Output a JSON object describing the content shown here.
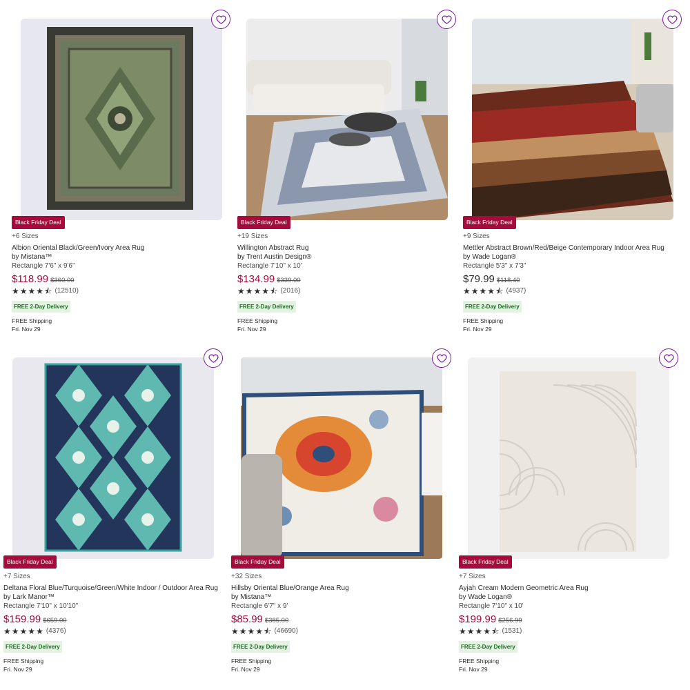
{
  "products": [
    {
      "badge": "Black Friday Deal",
      "sizes": "+6 Sizes",
      "name": "Albion Oriental Black/Green/Ivory Area Rug",
      "brand": "by Mistana™",
      "dims": "Rectangle 7'6\" x 9'6\"",
      "price": "$118.99",
      "was": "$360.00",
      "rating": 4.5,
      "reviews": "(12510)",
      "free": "FREE 2-Day Delivery",
      "ship": "FREE Shipping",
      "date": "Fri. Nov 29",
      "image": "rug-oriental-green"
    },
    {
      "badge": "Black Friday Deal",
      "sizes": "+19 Sizes",
      "name": "Willington Abstract Rug",
      "brand": "by Trent Austin Design®",
      "dims": "Rectangle 7'10\" x 10'",
      "price": "$134.99",
      "was": "$339.00",
      "rating": 4.5,
      "reviews": "(2016)",
      "free": "FREE 2-Day Delivery",
      "ship": "FREE Shipping",
      "date": "Fri. Nov 29",
      "image": "rug-abstract-blue-room"
    },
    {
      "badge": "Black Friday Deal",
      "sizes": "+9 Sizes",
      "name": "Mettler Abstract Brown/Red/Beige Contemporary Indoor Area Rug",
      "brand": "by Wade Logan®",
      "dims": "Rectangle 5'3\" x 7'3\"",
      "price": "$79.99",
      "was": "$118.40",
      "rating": 4.5,
      "reviews": "(4937)",
      "free": "FREE 2-Day Delivery",
      "ship": "FREE Shipping",
      "date": "Fri. Nov 29",
      "image": "rug-stripe-red-room"
    },
    {
      "badge": "Black Friday Deal",
      "sizes": "+7 Sizes",
      "name": "Deltana Floral Blue/Turquoise/Green/White Indoor / Outdoor Area Rug",
      "brand": "by Lark Manor™",
      "dims": "Rectangle 7'10\" x 10'10\"",
      "price": "$159.99",
      "was": "$659.00",
      "rating": 5,
      "reviews": "(4376)",
      "free": "FREE 2-Day Delivery",
      "ship": "FREE Shipping",
      "date": "Fri. Nov 29",
      "image": "rug-floral-turquoise"
    },
    {
      "badge": "Black Friday Deal",
      "sizes": "+32 Sizes",
      "name": "Hillsby Oriental Blue/Orange Area Rug",
      "brand": "by Mistana™",
      "dims": "Rectangle 6'7\" x 9'",
      "price": "$85.99",
      "was": "$385.00",
      "rating": 4.5,
      "reviews": "(46690)",
      "free": "FREE 2-Day Delivery",
      "ship": "FREE Shipping",
      "date": "Fri. Nov 29",
      "image": "rug-oriental-orange-room"
    },
    {
      "badge": "Black Friday Deal",
      "sizes": "+7 Sizes",
      "name": "Ayjah Cream Modern Geometric Area Rug",
      "brand": "by Wade Logan®",
      "dims": "Rectangle 7'10\" x 10'",
      "price": "$199.99",
      "was": "$256.99",
      "rating": 4.5,
      "reviews": "(1531)",
      "free": "FREE 2-Day Delivery",
      "ship": "FREE Shipping",
      "date": "Fri. Nov 29",
      "image": "rug-geometric-cream"
    }
  ],
  "colors": {
    "sale": "#a50b3b",
    "wishlist": "#7b189f",
    "free_badge_bg": "#e3f2e1",
    "free_badge_text": "#1d6b23"
  },
  "icons": {
    "wishlist": "heart-outline-icon",
    "rating": "star-icon"
  }
}
